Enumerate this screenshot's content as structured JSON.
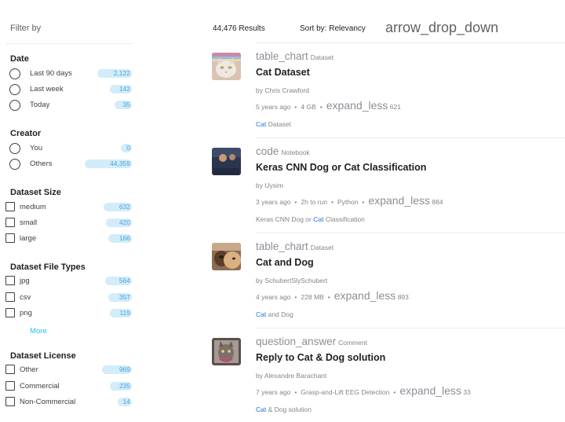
{
  "sidebar": {
    "title": "Filter by",
    "groups": [
      {
        "title": "Date",
        "type": "radio",
        "options": [
          {
            "label": "Last 90 days",
            "count": "2,122",
            "level": 0.83
          },
          {
            "label": "Last week",
            "count": "142",
            "level": 0.55
          },
          {
            "label": "Today",
            "count": "35",
            "level": 0.45
          }
        ]
      },
      {
        "title": "Creator",
        "type": "radio",
        "options": [
          {
            "label": "You",
            "count": "0",
            "level": 0.1
          },
          {
            "label": "Others",
            "count": "44,359",
            "level": 1.0
          }
        ]
      },
      {
        "title": "Dataset Size",
        "type": "checkbox",
        "options": [
          {
            "label": "medium",
            "count": "632",
            "level": 0.68
          },
          {
            "label": "small",
            "count": "420",
            "level": 0.6
          },
          {
            "label": "large",
            "count": "166",
            "level": 0.52
          }
        ]
      },
      {
        "title": "Dataset File Types",
        "type": "checkbox",
        "options": [
          {
            "label": "jpg",
            "count": "564",
            "level": 0.65
          },
          {
            "label": "csv",
            "count": "357",
            "level": 0.58
          },
          {
            "label": "png",
            "count": "119",
            "level": 0.5
          }
        ],
        "more": "More"
      },
      {
        "title": "Dataset License",
        "type": "checkbox",
        "options": [
          {
            "label": "Other",
            "count": "969",
            "level": 0.78
          },
          {
            "label": "Commercial",
            "count": "235",
            "level": 0.55
          },
          {
            "label": "Non-Commercial",
            "count": "14",
            "level": 0.3
          }
        ]
      }
    ]
  },
  "header": {
    "results": "44,476 Results",
    "sort_label": "Sort by:  Relevancy",
    "sort_icon": "arrow_drop_down"
  },
  "results": [
    {
      "type_icon": "table_chart",
      "kind": "Dataset",
      "title": "Cat Dataset",
      "author": "by Chris Crawford",
      "age": "5 years ago",
      "info": "4 GB",
      "vote_icon": "expand_less",
      "votes": "621",
      "tag_pre": "",
      "tag_hl": "Cat",
      "tag_post": " Dataset"
    },
    {
      "type_icon": "code",
      "kind": "Notebook",
      "title": "Keras CNN Dog or Cat Classification",
      "author": "by Uysim",
      "age": "3 years ago",
      "info": "2h to run",
      "info2": "Python",
      "vote_icon": "expand_less",
      "votes": "884",
      "tag_pre": "Keras CNN Dog or ",
      "tag_hl": "Cat",
      "tag_post": " Classification"
    },
    {
      "type_icon": "table_chart",
      "kind": "Dataset",
      "title": "Cat and Dog",
      "author": "by SchubertSlySchubert",
      "age": "4 years ago",
      "info": "228 MB",
      "vote_icon": "expand_less",
      "votes": "893",
      "tag_pre": "",
      "tag_hl": "Cat",
      "tag_post": " and Dog"
    },
    {
      "type_icon": "question_answer",
      "kind": "Comment",
      "title": "Reply to Cat & Dog solution",
      "author": "by Alexandre Barachant",
      "age": "7 years ago",
      "info": "Grasp-and-Lift EEG Detection",
      "vote_icon": "expand_less",
      "votes": "33",
      "tag_pre": "",
      "tag_hl": "Cat",
      "tag_post": " & Dog solution"
    }
  ],
  "colors": {
    "accent": "#20beff",
    "link": "#1a73e8",
    "count_bg": "#d2ecfa",
    "count_text": "#4aa5d8"
  }
}
